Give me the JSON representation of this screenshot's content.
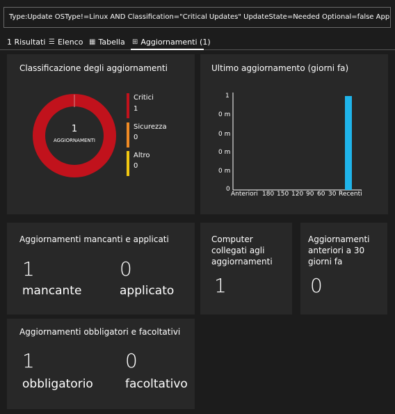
{
  "query": "Type:Update OSType!=Linux AND Classification=\"Critical Updates\" UpdateState=Needed Optional=false Approved!=false",
  "tabs": [
    {
      "label": "1 Risultati",
      "icon": ""
    },
    {
      "label": "Elenco",
      "icon": "list-icon"
    },
    {
      "label": "Tabella",
      "icon": "table-icon"
    },
    {
      "label": "Aggiornamenti (1)",
      "icon": "updates-icon"
    }
  ],
  "classification": {
    "title": "Classificazione degli aggiornamenti",
    "center_value": "1",
    "center_label": "AGGIORNAMENTI",
    "legend": [
      {
        "name": "Critici",
        "value": "1",
        "color": "#c1121c"
      },
      {
        "name": "Sicurezza",
        "value": "0",
        "color": "#f08a24"
      },
      {
        "name": "Altro",
        "value": "0",
        "color": "#f2c811"
      }
    ]
  },
  "last_update": {
    "title": "Ultimo aggiornamento (giorni fa)",
    "y_ticks": [
      "1",
      "0 m",
      "0 m",
      "0 m",
      "0 m",
      "0"
    ],
    "x_ticks": [
      "Anteriori",
      "180",
      "150",
      "120",
      "90",
      "60",
      "30",
      "Recenti"
    ],
    "bar_color": "#1fb4ea"
  },
  "chart_data": {
    "type": "bar",
    "title": "Ultimo aggiornamento (giorni fa)",
    "categories": [
      "Anteriori",
      "180",
      "150",
      "120",
      "90",
      "60",
      "30",
      "Recenti"
    ],
    "values": [
      0,
      0,
      0,
      0,
      0,
      0,
      0,
      1
    ],
    "ylim": [
      0,
      1
    ]
  },
  "missing_applied": {
    "title": "Aggiornamenti mancanti e applicati",
    "missing_value": "1",
    "missing_label": "mancante",
    "applied_value": "0",
    "applied_label": "applicato"
  },
  "computers": {
    "title": "Computer collegati agli aggiornamenti",
    "value": "1"
  },
  "older": {
    "title": "Aggiornamenti anteriori a 30 giorni fa",
    "value": "0"
  },
  "mandatory_optional": {
    "title": "Aggiornamenti obbligatori e facoltativi",
    "mandatory_value": "1",
    "mandatory_label": "obbligatorio",
    "optional_value": "0",
    "optional_label": "facoltativo"
  }
}
